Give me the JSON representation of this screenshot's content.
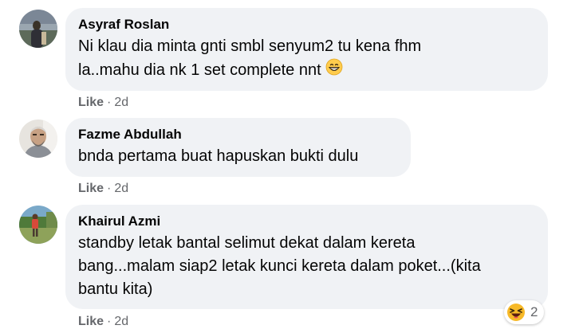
{
  "comments": [
    {
      "author": "Asyraf Roslan",
      "line1": "Ni klau dia minta gnti smbl senyum2 tu kena fhm",
      "line2": "la..mahu dia nk 1 set complete nnt",
      "emoji": "grinning-face-icon",
      "like_label": "Like",
      "separator": "·",
      "time": "2d"
    },
    {
      "author": "Fazme Abdullah",
      "line1": "bnda pertama buat hapuskan bukti dulu",
      "like_label": "Like",
      "separator": "·",
      "time": "2d"
    },
    {
      "author": "Khairul Azmi",
      "line1": "standby letak bantal selimut dekat dalam kereta",
      "line2": "bang...malam siap2 letak kunci kereta dalam poket...(kita",
      "line3": "bantu kita)",
      "like_label": "Like",
      "separator": "·",
      "time": "2d",
      "reaction": {
        "icon": "haha-reaction-icon",
        "count": "2"
      }
    }
  ],
  "colors": {
    "bubble": "#f0f2f5",
    "text": "#050505",
    "meta": "#65676b",
    "haha": "#f7b928"
  }
}
